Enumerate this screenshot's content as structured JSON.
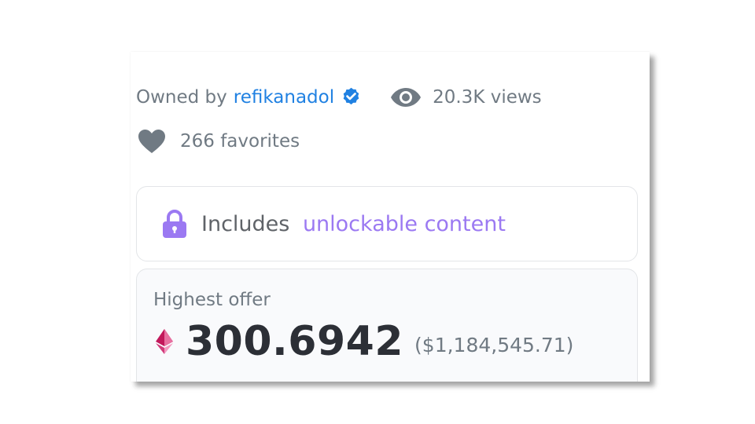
{
  "owner": {
    "prefix": "Owned by",
    "username": "refikanadol",
    "verified_icon": "verified-badge-icon"
  },
  "stats": {
    "views": "20.3K views",
    "favorites": "266 favorites"
  },
  "unlockable": {
    "prefix": "Includes",
    "link_text": "unlockable content",
    "icon": "lock-icon"
  },
  "offer": {
    "label": "Highest offer",
    "amount": "300.6942",
    "fiat": "($1,184,545.71)",
    "currency_icon": "ethereum-icon"
  },
  "colors": {
    "link_blue": "#2081e2",
    "accent_purple": "#9b79f2",
    "muted_text": "#707a83",
    "price_text": "#2c2f36"
  }
}
